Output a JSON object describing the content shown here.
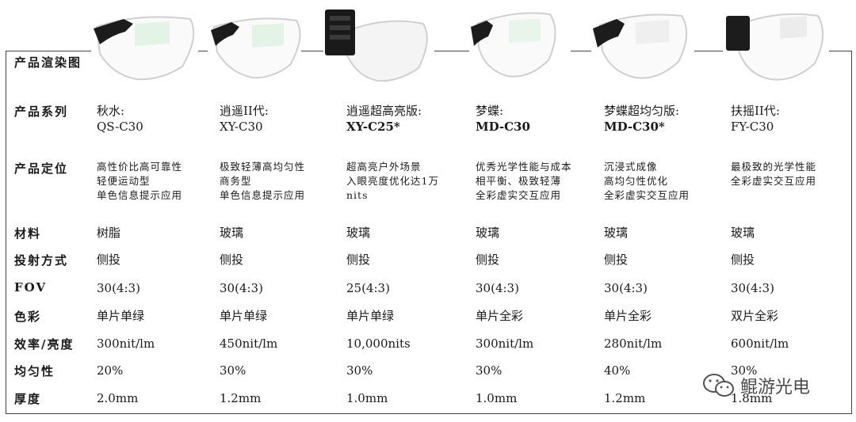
{
  "row_labels": {
    "render": "产品渲染图",
    "series": "产品系列",
    "position": "产品定位",
    "material": "材料",
    "projection": "投射方式",
    "fov": "FOV",
    "color": "色彩",
    "efficiency": "效率/亮度",
    "uniformity": "均匀性",
    "thickness": "厚度"
  },
  "products": [
    {
      "name": "秋水:",
      "code": "QS-C30",
      "position": [
        "高性价比高可靠性",
        "轻便运动型",
        "单色信息提示应用"
      ],
      "material": "树脂",
      "projection": "侧投",
      "fov": "30(4:3)",
      "color": "单片单绿",
      "efficiency": "300nit/lm",
      "uniformity": "20%",
      "thickness": "2.0mm"
    },
    {
      "name": "逍遥II代:",
      "code": "XY-C30",
      "position": [
        "极致轻薄高均匀性",
        "商务型",
        "单色信息提示应用"
      ],
      "material": "玻璃",
      "projection": "侧投",
      "fov": "30(4:3)",
      "color": "单片单绿",
      "efficiency": "450nit/lm",
      "uniformity": "30%",
      "thickness": "1.2mm"
    },
    {
      "name": "逍遥超高亮版:",
      "code": "XY-C25*",
      "position": [
        "超高亮户外场景",
        "入眼亮度优化达1万",
        "nits"
      ],
      "material": "玻璃",
      "projection": "侧投",
      "fov": "25(4:3)",
      "color": "单片单绿",
      "efficiency": "10,000nits",
      "uniformity": "30%",
      "thickness": "1.0mm"
    },
    {
      "name": "梦蝶:",
      "code": "MD-C30",
      "position": [
        "优秀光学性能与成本",
        "相平衡、极致轻薄",
        "全彩虚实交互应用"
      ],
      "material": "玻璃",
      "projection": "侧投",
      "fov": "30(4:3)",
      "color": "单片全彩",
      "efficiency": "300nit/lm",
      "uniformity": "30%",
      "thickness": "1.0mm"
    },
    {
      "name": "梦蝶超均匀版:",
      "code": "MD-C30*",
      "position": [
        "沉浸式成像",
        "高均匀性优化",
        "全彩虚实交互应用"
      ],
      "material": "玻璃",
      "projection": "侧投",
      "fov": "30(4:3)",
      "color": "单片全彩",
      "efficiency": "280nit/lm",
      "uniformity": "40%",
      "thickness": "1.2mm"
    },
    {
      "name": "扶摇II代:",
      "code": "FY-C30",
      "position": [
        "最极致的光学性能",
        "全彩虚实交互应用"
      ],
      "material": "玻璃",
      "projection": "侧投",
      "fov": "30(4:3)",
      "color": "双片全彩",
      "efficiency": "600nit/lm",
      "uniformity": "30%",
      "thickness": "1.8mm"
    }
  ],
  "watermark": "鲲游光电"
}
